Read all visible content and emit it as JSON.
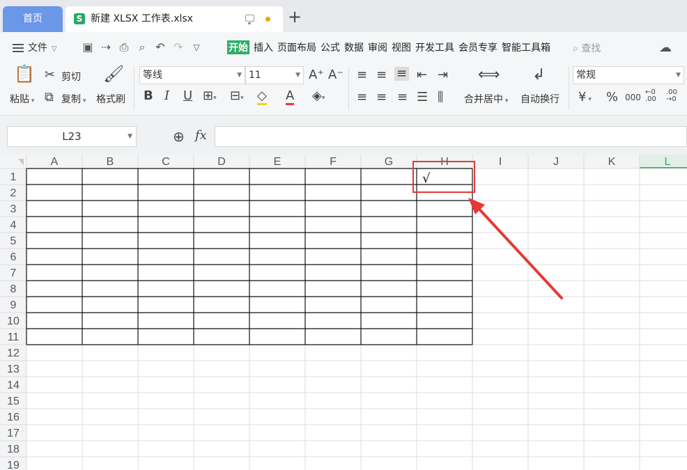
{
  "tabs": {
    "home_label": "首页",
    "doc_icon": "S",
    "doc_title": "新建 XLSX 工作表.xlsx",
    "add_icon": "+"
  },
  "menu": {
    "file_label": "文件",
    "ribbon_tabs": [
      "开始",
      "插入",
      "页面布局",
      "公式",
      "数据",
      "审阅",
      "视图",
      "开发工具",
      "会员专享",
      "智能工具箱"
    ],
    "active_tab": "开始",
    "search_label": "查找"
  },
  "ribbon": {
    "paste": "粘贴",
    "cut": "剪切",
    "copy": "复制",
    "format_painter": "格式刷",
    "font_name": "等线",
    "font_size": "11",
    "merge_center": "合并居中",
    "wrap_text": "自动换行",
    "number_format": "常规",
    "currency_symbol": "¥",
    "percent_symbol": "%",
    "thousands_symbol": "000"
  },
  "formula_bar": {
    "cell_ref": "L23",
    "fx_label": "fx",
    "formula_value": ""
  },
  "sheet": {
    "columns": [
      "A",
      "B",
      "C",
      "D",
      "E",
      "F",
      "G",
      "H",
      "I",
      "J",
      "K",
      "L"
    ],
    "rows": [
      "1",
      "2",
      "3",
      "4",
      "5",
      "6",
      "7",
      "8",
      "9",
      "10",
      "11",
      "12",
      "13",
      "14",
      "15",
      "16",
      "17",
      "18",
      "19"
    ],
    "selected_column": "L",
    "cell_H1": "√",
    "highlight_color": "#e53935",
    "accent_color": "#2bae66"
  }
}
